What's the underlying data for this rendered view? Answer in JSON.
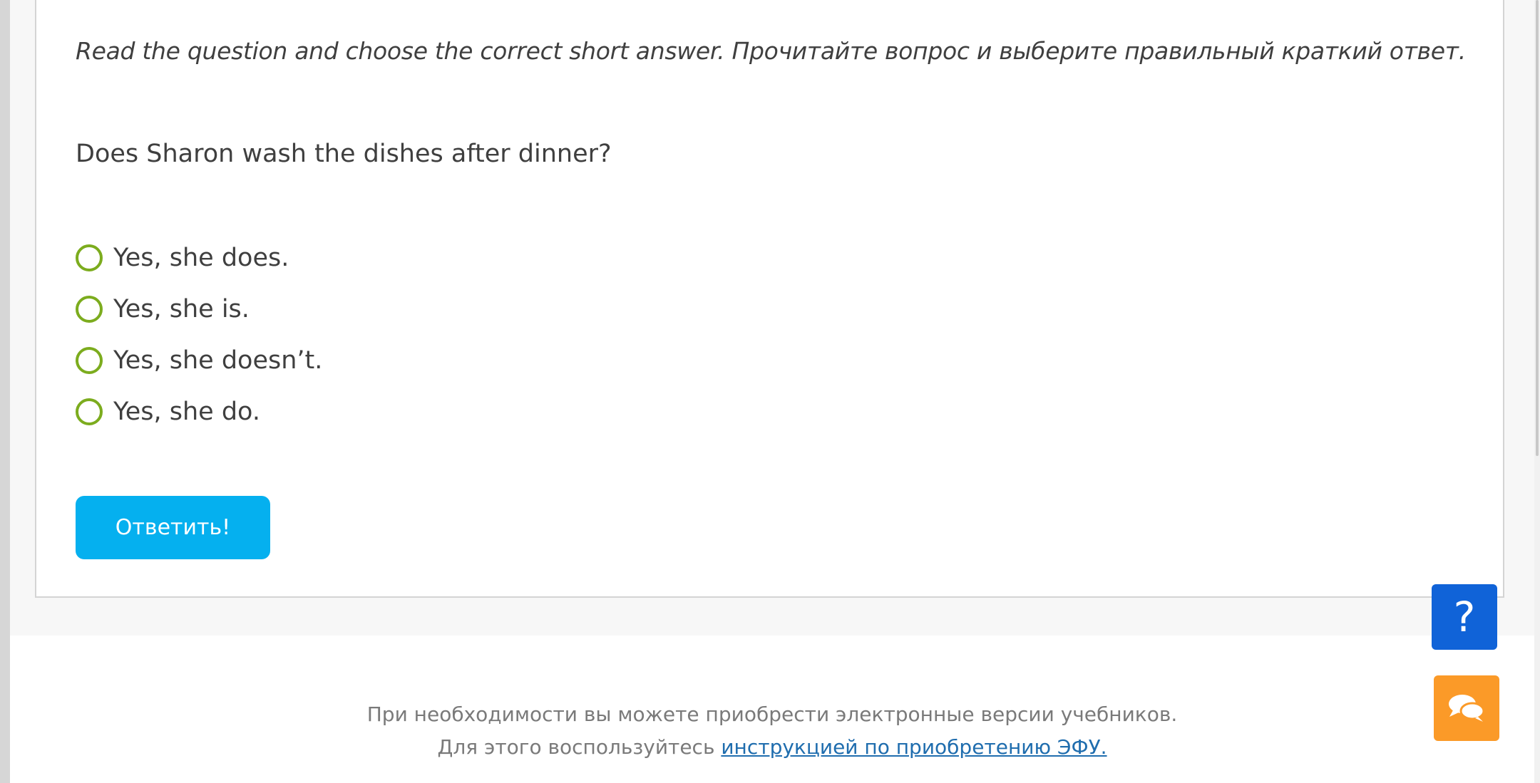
{
  "task": {
    "instruction": "Read the question and choose the correct short answer. Прочитайте вопрос и выберите правильный краткий ответ.",
    "question": "Does Sharon wash the dishes after dinner?",
    "options": [
      {
        "label": "Yes, she does."
      },
      {
        "label": "Yes, she is."
      },
      {
        "label": "Yes, she doesn’t."
      },
      {
        "label": "Yes, she do."
      }
    ],
    "submit_label": "Ответить!"
  },
  "footer": {
    "line1": "При необходимости вы можете приобрести электронные версии учебников.",
    "line2_prefix": "Для этого воспользуйтесь ",
    "link_text": "инструкцией по приобретению ЭФУ."
  },
  "widgets": {
    "help_label": "?",
    "help_color": "#1063d8",
    "chat_icon": "chat-bubbles-icon",
    "chat_color": "#fb9a28"
  },
  "colors": {
    "radio_border": "#7cac1e",
    "button": "#05b0ef",
    "link": "#1f6dae"
  }
}
